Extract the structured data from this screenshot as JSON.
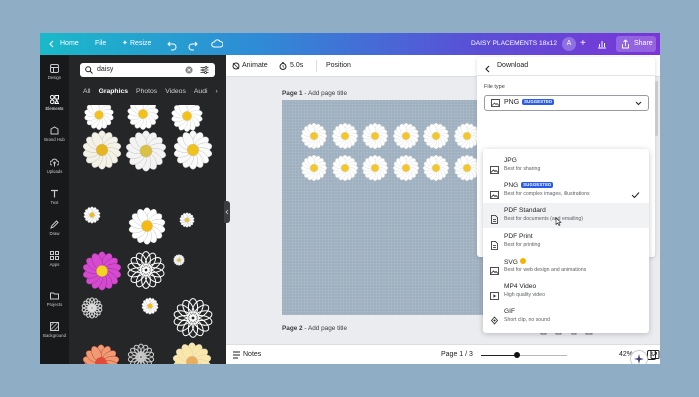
{
  "topbar": {
    "home": "Home",
    "file": "File",
    "resize": "Resize",
    "doc_title": "DAISY PLACEMENTS 18x12",
    "avatar_initial": "A",
    "share": "Share",
    "gradient_colors": [
      "#19b9c9",
      "#7a35d8"
    ]
  },
  "rail": {
    "items": [
      {
        "label": "Design",
        "icon": "layout-icon"
      },
      {
        "label": "Elements",
        "icon": "shapes-icon"
      },
      {
        "label": "Brand Hub",
        "icon": "brand-icon"
      },
      {
        "label": "Uploads",
        "icon": "upload-icon"
      },
      {
        "label": "Text",
        "icon": "text-icon"
      },
      {
        "label": "Draw",
        "icon": "pen-icon"
      },
      {
        "label": "Apps",
        "icon": "apps-icon"
      },
      {
        "label": "Projects",
        "icon": "folder-icon"
      },
      {
        "label": "Background",
        "icon": "background-icon"
      }
    ]
  },
  "panel": {
    "search_value": "daisy",
    "tabs": [
      "All",
      "Graphics",
      "Photos",
      "Videos",
      "Audi"
    ],
    "selected_tab": "Graphics"
  },
  "toolbar": {
    "animate": "Animate",
    "duration": "5.0s",
    "position": "Position"
  },
  "canvas": {
    "page1_label": "Page 1",
    "page1_title_placeholder": "Add page title",
    "page2_label": "Page 2",
    "page2_title_placeholder": "Add page title",
    "page_background": "#9fb0c0"
  },
  "download": {
    "title": "Download",
    "file_type_label": "File type",
    "selected": "PNG",
    "selected_badge": "SUGGESTED",
    "options": [
      {
        "name": "JPG",
        "desc": "Best for sharing",
        "icon": "image-icon"
      },
      {
        "name": "PNG",
        "badge": "SUGGESTED",
        "desc": "Best for complex images, illustrations",
        "icon": "image-icon",
        "checked": true
      },
      {
        "name": "PDF Standard",
        "desc": "Best for documents (and emailing)",
        "icon": "document-icon",
        "hovered": true
      },
      {
        "name": "PDF Print",
        "desc": "Best for printing",
        "icon": "document-icon"
      },
      {
        "name": "SVG",
        "desc": "Best for web design and animations",
        "icon": "image-icon",
        "pro": true
      },
      {
        "name": "MP4 Video",
        "desc": "High quality video",
        "icon": "video-icon"
      },
      {
        "name": "GIF",
        "desc": "Short clip, no sound",
        "icon": "gif-icon"
      }
    ]
  },
  "bottombar": {
    "notes": "Notes",
    "page_indicator": "Page 1 / 3",
    "zoom": "42%",
    "zoom_fraction": 0.42,
    "page_count_badge": "3"
  }
}
